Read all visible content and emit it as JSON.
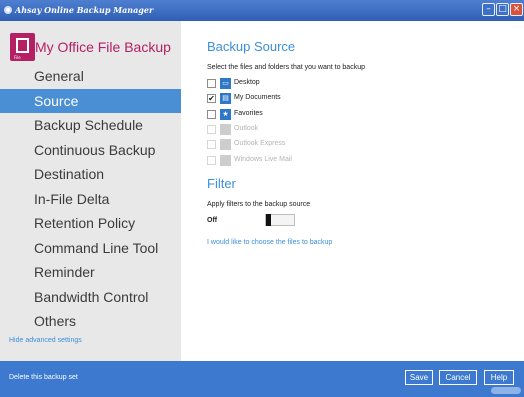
{
  "window": {
    "title": "Ahsay Online Backup Manager",
    "min_glyph": "–",
    "max_glyph": "□",
    "close_glyph": "×"
  },
  "sidebar": {
    "brand_title": "My Office File Backup",
    "brand_tag": "File",
    "items": [
      {
        "label": "General"
      },
      {
        "label": "Source"
      },
      {
        "label": "Backup Schedule"
      },
      {
        "label": "Continuous Backup"
      },
      {
        "label": "Destination"
      },
      {
        "label": "In-File Delta"
      },
      {
        "label": "Retention Policy"
      },
      {
        "label": "Command Line Tool"
      },
      {
        "label": "Reminder"
      },
      {
        "label": "Bandwidth Control"
      },
      {
        "label": "Others"
      }
    ],
    "active_index": 1,
    "hide_advanced_label": "Hide advanced settings"
  },
  "main": {
    "source_title": "Backup Source",
    "source_caption": "Select the files and folders that you want to backup",
    "files": [
      {
        "label": "Desktop",
        "checked": false,
        "enabled": true,
        "icon": "desktop-icon",
        "glyph": "▭"
      },
      {
        "label": "My Documents",
        "checked": true,
        "enabled": true,
        "icon": "documents-icon",
        "glyph": "▤"
      },
      {
        "label": "Favorites",
        "checked": false,
        "enabled": true,
        "icon": "star-icon",
        "glyph": "★"
      },
      {
        "label": "Outlook",
        "checked": false,
        "enabled": false,
        "icon": "outlook-icon",
        "glyph": ""
      },
      {
        "label": "Outlook Express",
        "checked": false,
        "enabled": false,
        "icon": "outlook-express-icon",
        "glyph": ""
      },
      {
        "label": "Windows Live Mail",
        "checked": false,
        "enabled": false,
        "icon": "windows-live-mail-icon",
        "glyph": ""
      }
    ],
    "filter_title": "Filter",
    "filter_caption": "Apply filters to the backup source",
    "filter_state": "Off",
    "choose_files_link": "I would like to choose the files to backup"
  },
  "footer": {
    "delete_label": "Delete this backup set",
    "save_label": "Save",
    "cancel_label": "Cancel",
    "help_label": "Help"
  },
  "colors": {
    "accent": "#3c8fd8",
    "brand": "#b51f63",
    "footer": "#3c79cf",
    "active_nav": "#4a8fd4",
    "sidebar_bg": "#e8e8e8"
  }
}
